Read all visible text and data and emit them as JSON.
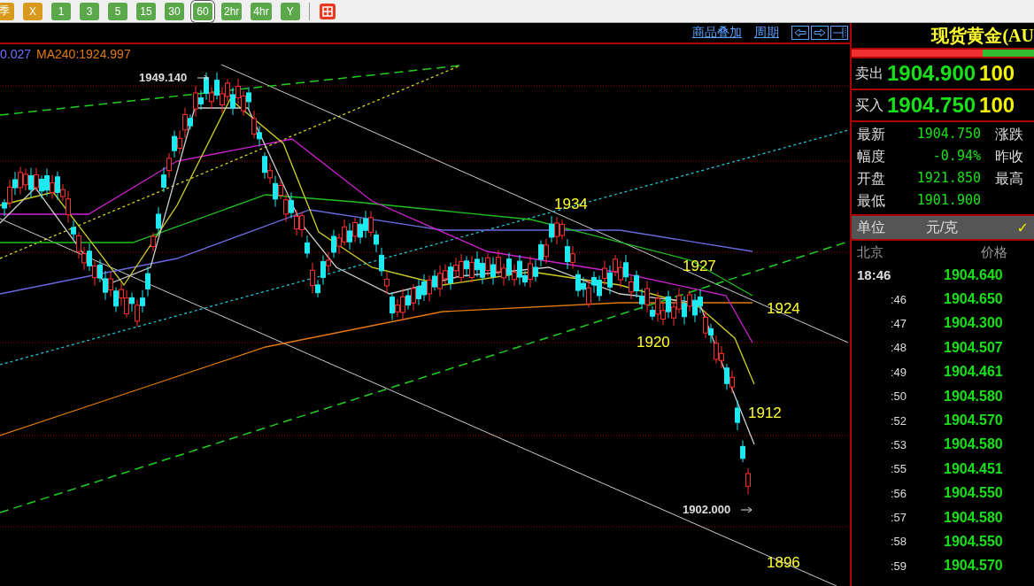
{
  "toolbar": {
    "buttons": [
      {
        "label": "季",
        "color": "#d89a1c",
        "selected": false
      },
      {
        "label": "X",
        "color": "#d89a1c",
        "selected": false
      },
      {
        "label": "1",
        "color": "#5aa84a",
        "selected": false
      },
      {
        "label": "3",
        "color": "#5aa84a",
        "selected": false
      },
      {
        "label": "5",
        "color": "#5aa84a",
        "selected": false
      },
      {
        "label": "15",
        "color": "#5aa84a",
        "selected": false
      },
      {
        "label": "30",
        "color": "#5aa84a",
        "selected": false
      },
      {
        "label": "60",
        "color": "#5aa84a",
        "selected": true
      },
      {
        "label": "2hr",
        "color": "#5aa84a",
        "selected": false
      },
      {
        "label": "4hr",
        "color": "#5aa84a",
        "selected": false
      },
      {
        "label": "Y",
        "color": "#5aa84a",
        "selected": false
      }
    ]
  },
  "chart": {
    "links": [
      "商品叠加",
      "周期"
    ],
    "legend": [
      {
        "text": "0.027",
        "color": "#7070ff"
      },
      {
        "text": "MA240:1924.997",
        "color": "#e07a10"
      }
    ],
    "annotations": [
      {
        "text": "1949.140",
        "kind": "price"
      },
      {
        "text": "1934",
        "kind": "level"
      },
      {
        "text": "1927",
        "kind": "level"
      },
      {
        "text": "1924",
        "kind": "level"
      },
      {
        "text": "1920",
        "kind": "level"
      },
      {
        "text": "1912",
        "kind": "level"
      },
      {
        "text": "1902.000",
        "kind": "price"
      },
      {
        "text": "1896",
        "kind": "level"
      }
    ]
  },
  "quote": {
    "title": "现货黄金(AU",
    "level": 0.72,
    "sell": {
      "label": "卖出",
      "price": "1904.900",
      "volume": "100"
    },
    "buy": {
      "label": "买入",
      "price": "1904.750",
      "volume": "100"
    },
    "stats": [
      {
        "label": "最新",
        "value": "1904.750",
        "label_2": "涨跌"
      },
      {
        "label": "幅度",
        "value": "-0.94%",
        "label_2": "昨收"
      },
      {
        "label": "开盘",
        "value": "1921.850",
        "label_2": "最高"
      },
      {
        "label": "最低",
        "value": "1901.900"
      }
    ],
    "unit": {
      "label": "单位",
      "value": "元/克",
      "mark": "✓"
    },
    "ticks": {
      "columns": [
        "北京",
        "价格"
      ],
      "rows": [
        {
          "time": "18:46",
          "price": "1904.640"
        },
        {
          "time": ":46",
          "price": "1904.650"
        },
        {
          "time": ":47",
          "price": "1904.300"
        },
        {
          "time": ":48",
          "price": "1904.507"
        },
        {
          "time": ":49",
          "price": "1904.461"
        },
        {
          "time": ":50",
          "price": "1904.580"
        },
        {
          "time": ":52",
          "price": "1904.570"
        },
        {
          "time": ":53",
          "price": "1904.580"
        },
        {
          "time": ":55",
          "price": "1904.451"
        },
        {
          "time": ":56",
          "price": "1904.550"
        },
        {
          "time": ":57",
          "price": "1904.580"
        },
        {
          "time": ":58",
          "price": "1904.550"
        },
        {
          "time": ":59",
          "price": "1904.570"
        }
      ]
    }
  }
}
